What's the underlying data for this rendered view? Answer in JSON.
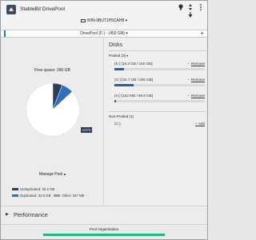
{
  "app": {
    "title": "StableBit DrivePool",
    "logo": "drivepool-logo"
  },
  "titlebar": {
    "icons": [
      "bulb-icon",
      "arrows-icon",
      "down-arrow-icon",
      "menu-icon"
    ],
    "machine": "WIN-9BUT1P5CAH8"
  },
  "pool": {
    "selector": "DrivePool (F:) - (450 GB)"
  },
  "left": {
    "free_space": "Free space: 390 GB",
    "badge": "NTFS",
    "manage": "Manage Pool",
    "legend": {
      "unduplicated": "Unduplicated: 26.2 GB",
      "duplicated": "Duplicated: 32.6 GB",
      "other": "Other: 347 MB"
    }
  },
  "chart_data": {
    "type": "pie",
    "total_gb": 450,
    "slices": [
      {
        "name": "Unduplicated",
        "value": 26.2,
        "color": "#2c3f57"
      },
      {
        "name": "Duplicated",
        "value": 32.6,
        "color": "#2f6fbd"
      },
      {
        "name": "Other",
        "value": 0.347,
        "color": "#9a9a9a"
      },
      {
        "name": "Free space",
        "value": 390,
        "color": "#ffffff"
      }
    ]
  },
  "right": {
    "title": "Disks",
    "pooled_header": "Pooled (3)",
    "disks": [
      {
        "label": "(E:) [16.3 GB / 150 GB]",
        "used": 0.109,
        "action": "Remove"
      },
      {
        "label": "(G:) [42.7 GB / 200 GB]",
        "used": 0.214,
        "action": "Remove"
      },
      {
        "label": "(H:) [152 MB / 99.9 GB]",
        "used": 0.015,
        "action": "Remove"
      }
    ],
    "nonpooled_header": "Non-Pooled (1)",
    "nonpooled": [
      {
        "label": "(C:)",
        "action": "Add"
      }
    ]
  },
  "bottom": {
    "performance": "Performance",
    "status": "Pool Organization",
    "status_progress": 1.0
  },
  "colors": {
    "accent": "#1f7fd8",
    "progress": "#26b38f",
    "dark": "#2c3f57"
  }
}
